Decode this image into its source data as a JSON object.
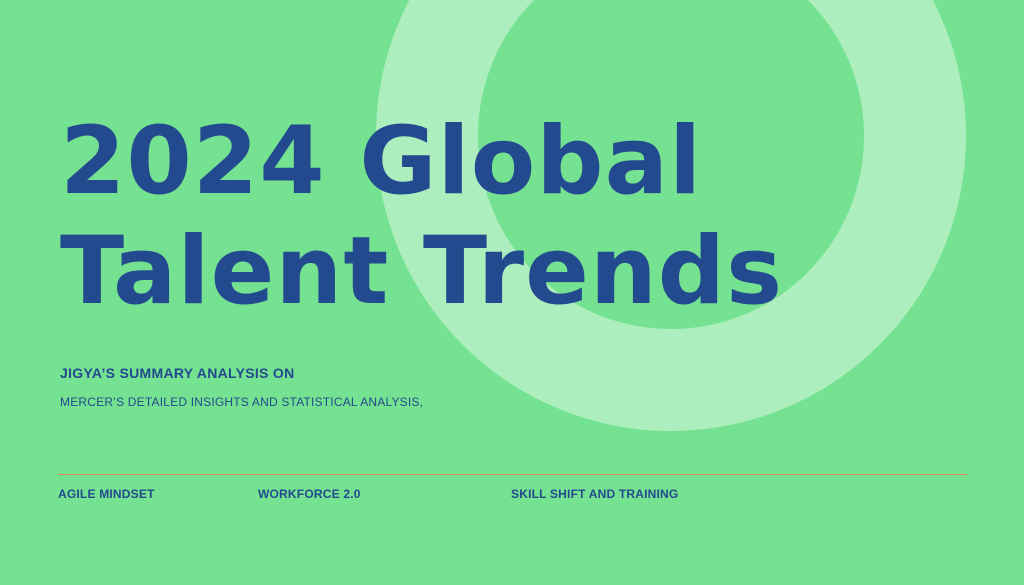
{
  "colors": {
    "background": "#74e290",
    "ring": "#aceebd",
    "text": "#234a8f",
    "divider": "#e3845a"
  },
  "slide": {
    "title_line_1": "2024 Global",
    "title_line_2": "Talent Trends",
    "subtitle": "JIGYA’S SUMMARY ANALYSIS ON",
    "description": "MERCER’S DETAILED INSIGHTS AND STATISTICAL ANALYSIS,",
    "footer_items": [
      "AGILE MINDSET",
      "WORKFORCE 2.0",
      "SKILL SHIFT AND TRAINING"
    ]
  }
}
